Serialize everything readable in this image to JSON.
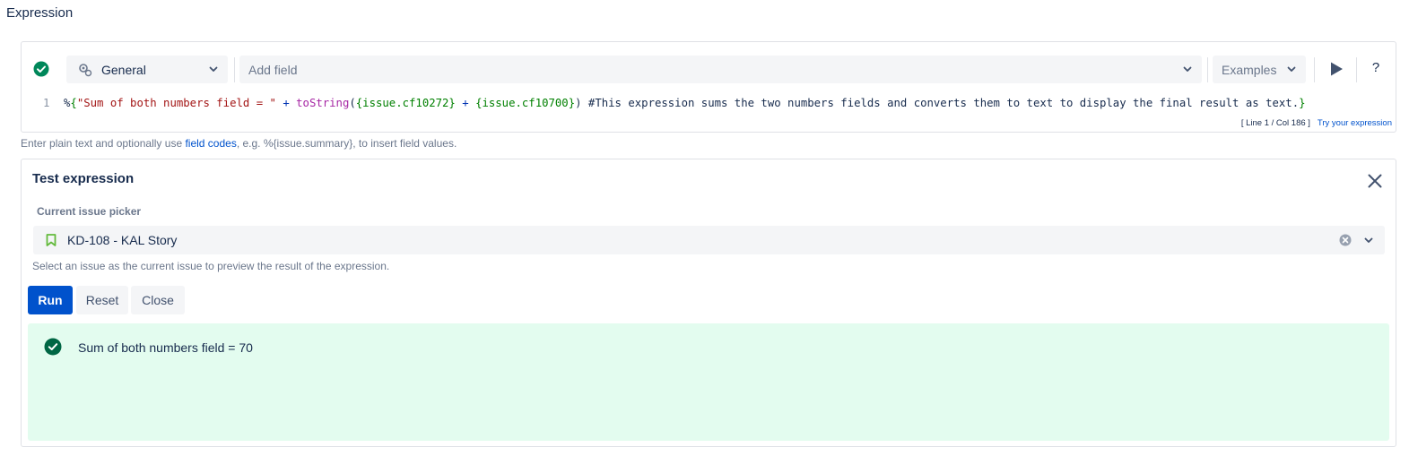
{
  "section_title": "Expression",
  "toolbar": {
    "context_select": "General",
    "add_field_placeholder": "Add field",
    "examples_label": "Examples",
    "help_label": "?"
  },
  "editor": {
    "line_number": "1",
    "tokens": {
      "prefix": "%",
      "open_brace": "{",
      "string": "\"Sum of both numbers field = \"",
      "plus1": " + ",
      "fn": "toString",
      "paren_open": "(",
      "field1": "{issue.cf10272}",
      "plus2": " + ",
      "field2": "{issue.cf10700}",
      "paren_close": ")",
      "comment": " #This expression sums the two numbers fields and converts them to text to display the final result as text.",
      "close_brace": "}"
    },
    "status": "[ Line 1 / Col 186 ]",
    "try_link": "Try your expression"
  },
  "hint": {
    "before": "Enter plain text and optionally use ",
    "link": "field codes",
    "after": ", e.g. %{issue.summary}, to insert field values."
  },
  "test_panel": {
    "title": "Test expression",
    "picker_label": "Current issue picker",
    "picker_value": "KD-108 - KAL Story",
    "picker_help": "Select an issue as the current issue to preview the result of the expression.",
    "buttons": {
      "run": "Run",
      "reset": "Reset",
      "close": "Close"
    },
    "result_text": "Sum of both numbers field = 70"
  },
  "icons": {
    "valid": "check-circle-icon",
    "general": "gear-icon",
    "run": "play-icon",
    "close": "close-icon",
    "issue_type": "bookmark-icon",
    "clear": "clear-icon",
    "result": "check-circle-icon"
  },
  "colors": {
    "primary": "#0052cc",
    "success": "#00875a",
    "success_bg": "#e3fcef",
    "story": "#63ba3c"
  }
}
